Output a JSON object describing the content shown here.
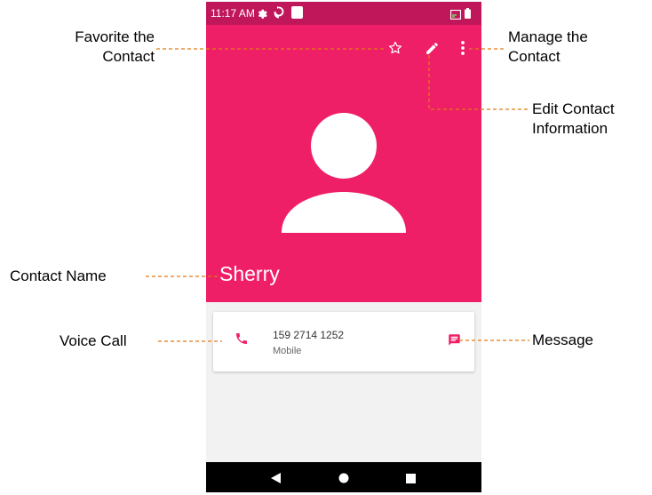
{
  "status_bar": {
    "time": "11:17 AM"
  },
  "contact": {
    "name": "Sherry",
    "phone_number": "159 2714 1252",
    "phone_type": "Mobile"
  },
  "colors": {
    "accent": "#ef1f67",
    "status_bar": "#c0175b",
    "callout_line": "#e07b17"
  },
  "icons": {
    "favorite": "star-outline-icon",
    "edit": "pencil-icon",
    "menu": "more-vert-icon",
    "call": "phone-icon",
    "message": "message-icon"
  },
  "annotations": {
    "favorite": {
      "line1": "Favorite the",
      "line2": "Contact"
    },
    "manage": {
      "line1": "Manage the",
      "line2": "Contact"
    },
    "edit": {
      "line1": "Edit Contact",
      "line2": "Information"
    },
    "contact_name": "Contact Name",
    "voice_call": "Voice Call",
    "message": "Message"
  }
}
